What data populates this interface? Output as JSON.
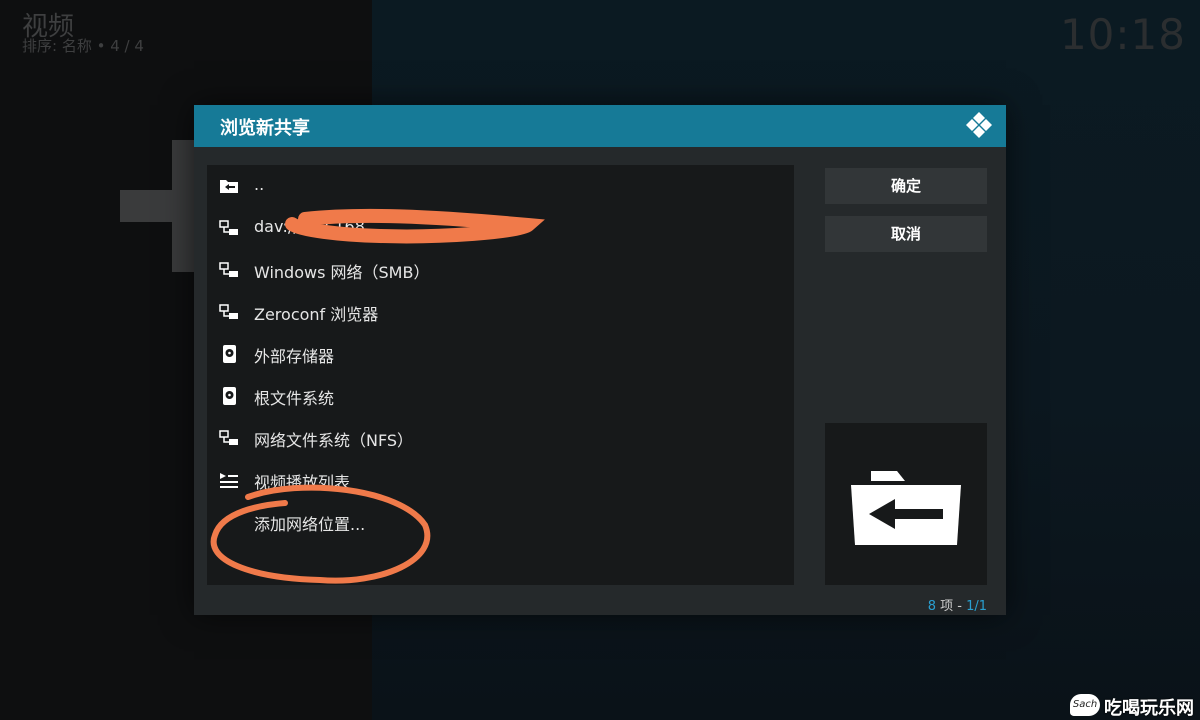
{
  "top": {
    "section_title": "视频",
    "sort_line": "排序: 名称  •  4 / 4",
    "clock": "10:18"
  },
  "dialog": {
    "title": "浏览新共享",
    "logo_icon": "kodi-logo-icon",
    "items": [
      {
        "label": "..",
        "icon": "folder-back-icon"
      },
      {
        "label": "dav://192.168.…",
        "icon": "network-icon"
      },
      {
        "label": "Windows 网络（SMB）",
        "icon": "network-icon"
      },
      {
        "label": "Zeroconf 浏览器",
        "icon": "network-icon"
      },
      {
        "label": "外部存储器",
        "icon": "hard-drive-icon"
      },
      {
        "label": "根文件系统",
        "icon": "hard-drive-icon"
      },
      {
        "label": "网络文件系统（NFS）",
        "icon": "network-icon"
      },
      {
        "label": "视频播放列表",
        "icon": "playlist-icon"
      },
      {
        "label": "添加网络位置...",
        "icon": ""
      }
    ],
    "ok_label": "确定",
    "cancel_label": "取消",
    "thumb_icon": "folder-back-icon",
    "count": {
      "items_num": "8",
      "items_word": " 项 - ",
      "page": "1/1"
    }
  },
  "watermark": {
    "bubble": "Sach",
    "text": "吃喝玩乐网"
  },
  "colors": {
    "header": "#167a97",
    "accent": "#2a9fd0",
    "annotation": "#f07a4a"
  }
}
